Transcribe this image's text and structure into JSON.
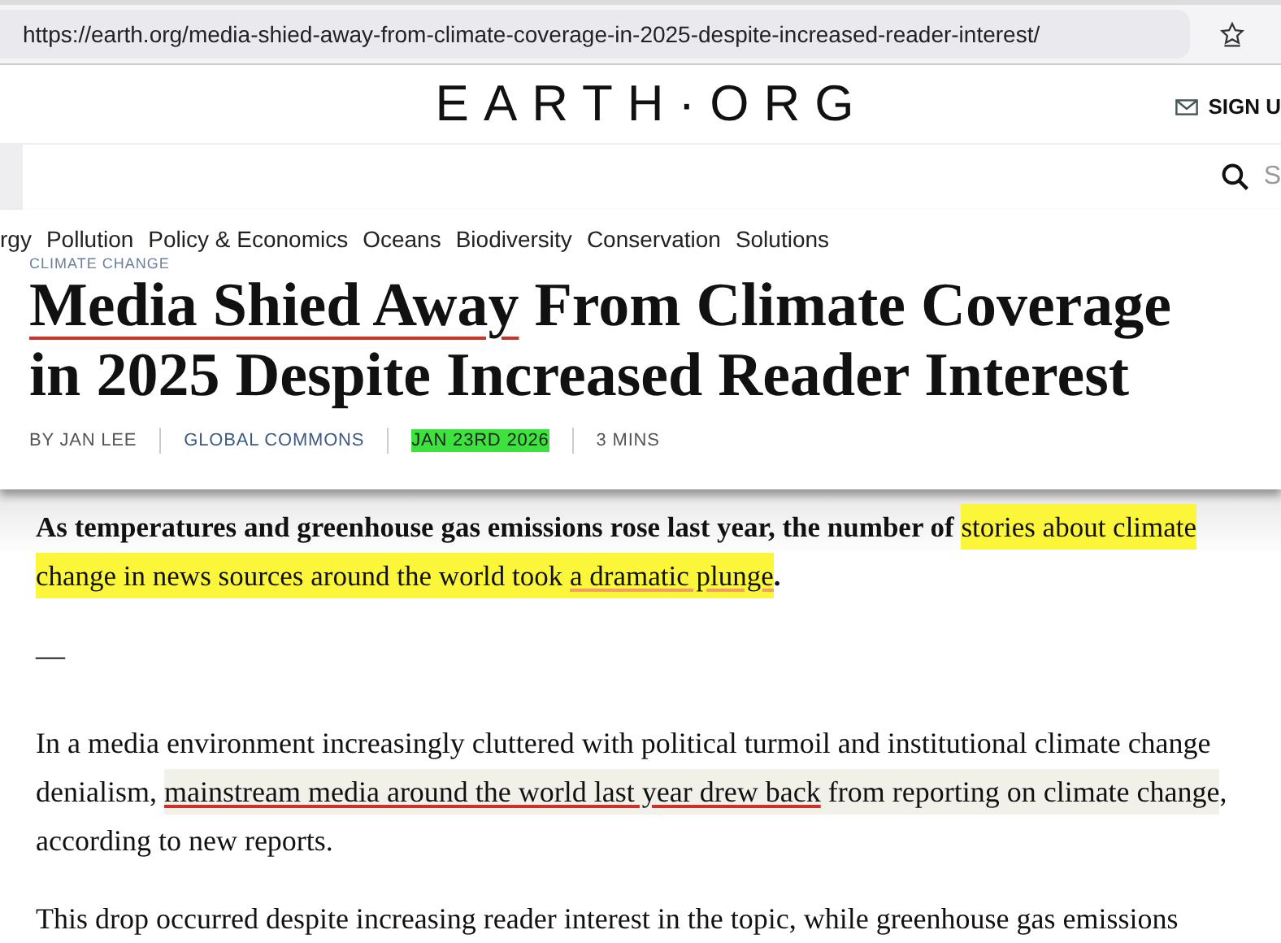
{
  "browser": {
    "url": "https://earth.org/media-shied-away-from-climate-coverage-in-2025-despite-increased-reader-interest/"
  },
  "header": {
    "logo": "EARTH·ORG",
    "signup": "SIGN U",
    "search_placeholder": "S"
  },
  "nav": {
    "items": [
      "rgy",
      "Pollution",
      "Policy & Economics",
      "Oceans",
      "Biodiversity",
      "Conservation",
      "Solutions"
    ]
  },
  "article": {
    "category": "CLIMATE CHANGE",
    "title": [
      {
        "text": "Media Shied Away",
        "underline": true
      },
      {
        "text": " From Climate Coverage in 2025 Despite Increased Reader Interest",
        "underline": false
      }
    ],
    "meta": [
      {
        "text": "BY JAN LEE",
        "highlight": false
      },
      {
        "text": "GLOBAL COMMONS",
        "highlight": false
      },
      {
        "text": "JAN 23RD 2026",
        "highlight": true
      },
      {
        "text": "3 MINS",
        "highlight": false
      }
    ],
    "paragraphs": [
      {
        "kind": "lead",
        "segments": [
          {
            "text": "As temperatures and greenhouse gas emissions rose last year, the number of ",
            "underline": false
          },
          {
            "text": "stories about climate change in news sources around the world took ",
            "color": "#fbf63a",
            "underline": false
          },
          {
            "text": "a dramatic plunge",
            "color": "#fbf63a",
            "underline": true
          },
          {
            "text": ".",
            "underline": false
          }
        ]
      },
      {
        "kind": "dash",
        "segments": [
          {
            "text": "—",
            "underline": false
          }
        ]
      },
      {
        "kind": "body",
        "segments": [
          {
            "text": "In a media environment increasingly cluttered with political turmoil and institutional climate change denialism, ",
            "underline": false
          },
          {
            "text": "mainstream media around the world last year drew back",
            "color": "#f1f1ea",
            "underline": true
          },
          {
            "text": " from reporting on climate change",
            "color": "#f1f1ea",
            "underline": false
          },
          {
            "text": ", according to new reports.",
            "underline": false
          }
        ]
      },
      {
        "kind": "body",
        "segments": [
          {
            "text": "This drop occurred despite increasing reader interest in the topic, while greenhouse gas emissions",
            "underline": false
          }
        ]
      }
    ]
  }
}
